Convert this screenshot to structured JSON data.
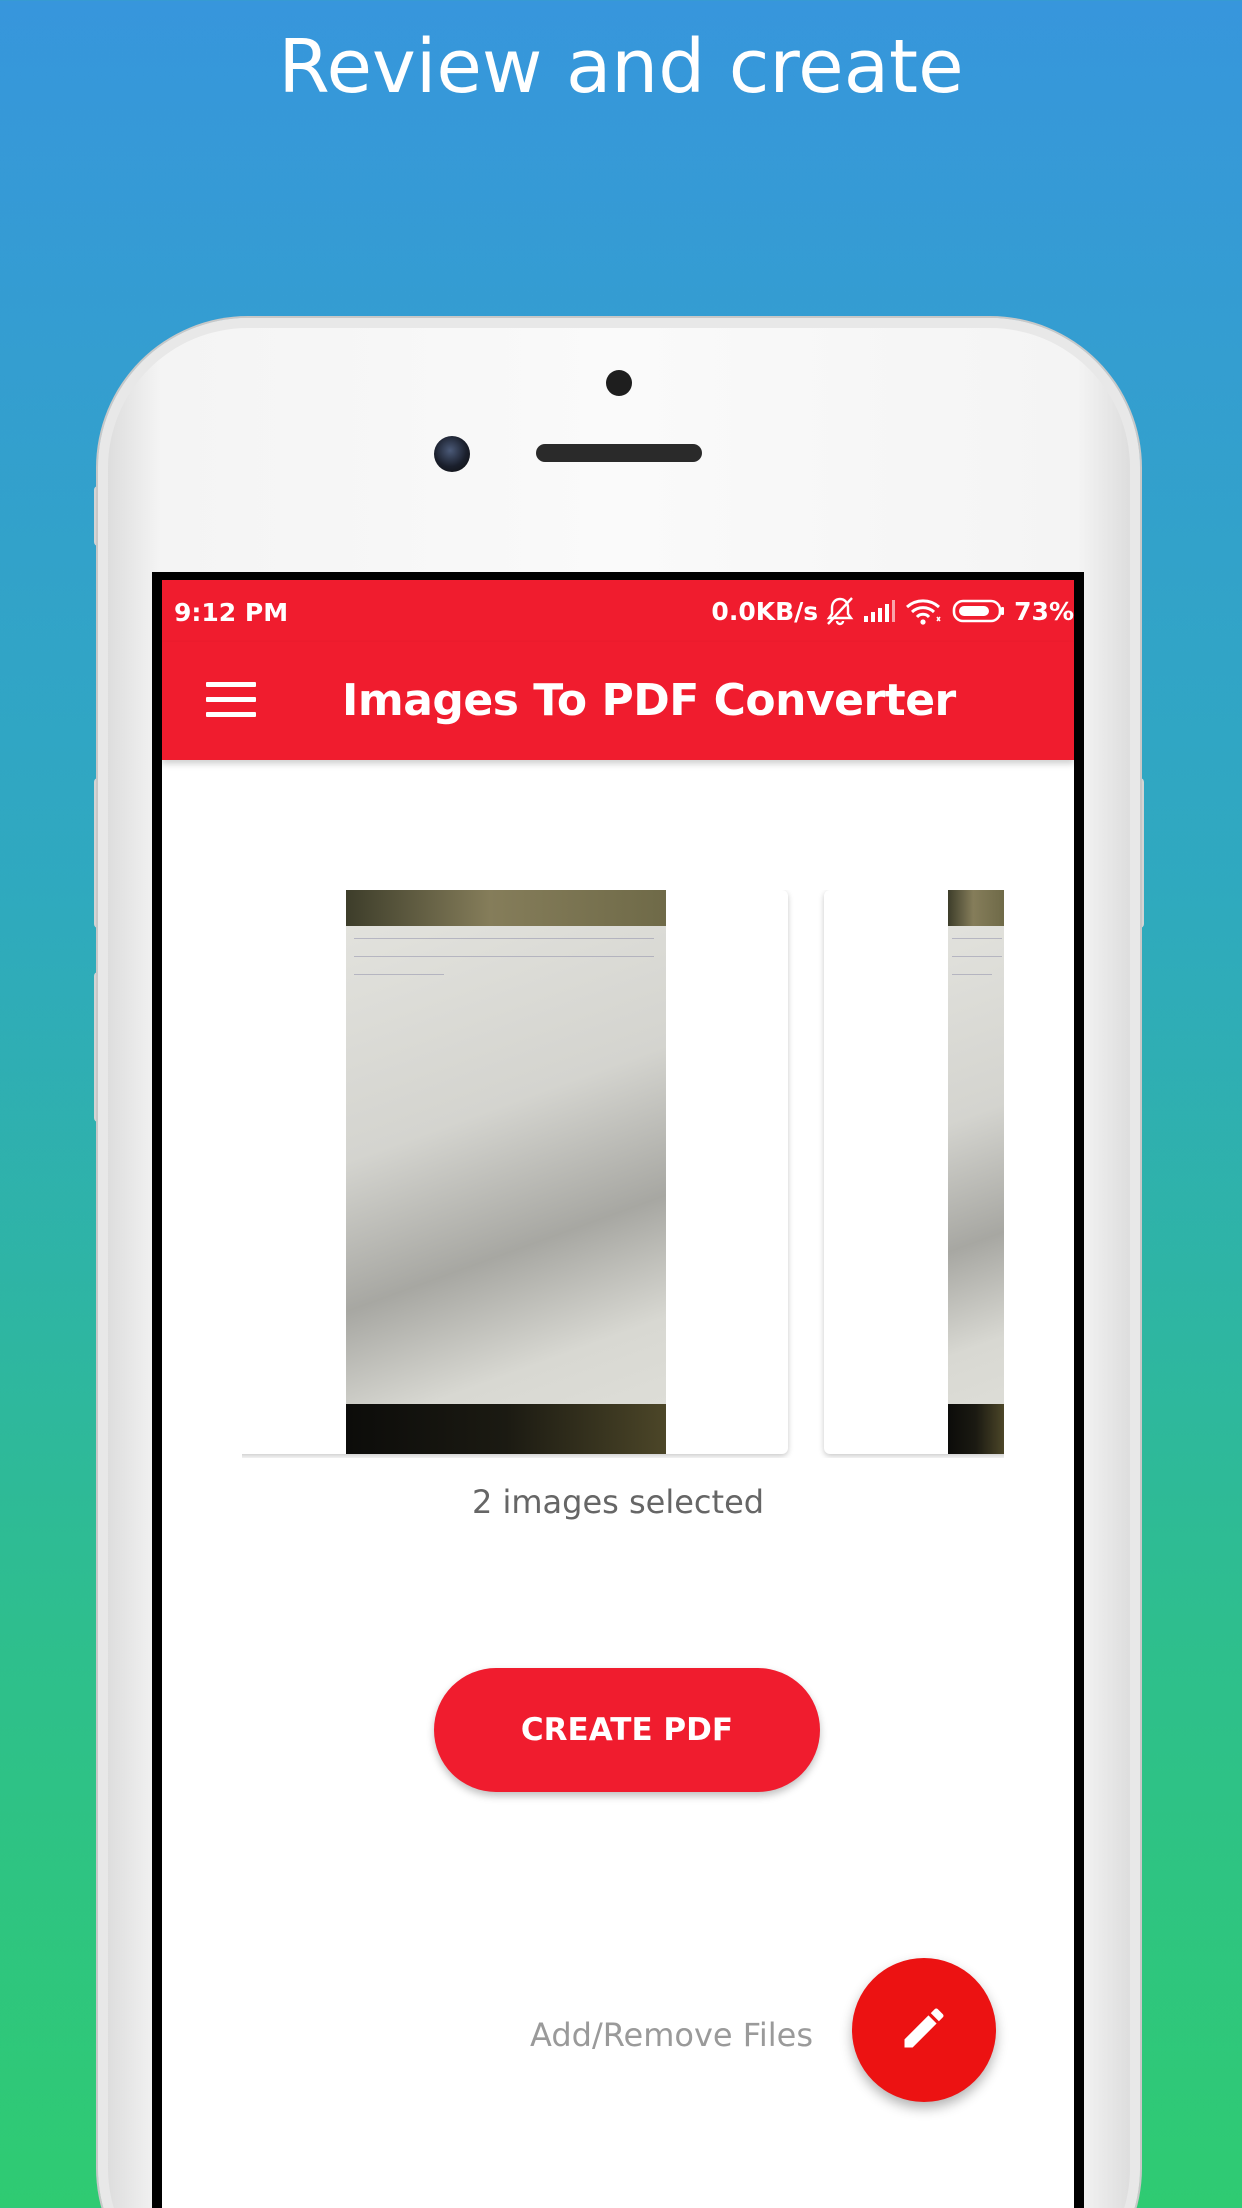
{
  "promo": {
    "title": "Review and create"
  },
  "status_bar": {
    "time": "9:12 PM",
    "network_speed": "0.0KB/s",
    "battery_percent": "73%",
    "icons": [
      "bell-muted-icon",
      "signal-icon",
      "wifi-icon",
      "battery-icon"
    ]
  },
  "app_bar": {
    "title": "Images To PDF Converter",
    "menu_icon": "hamburger-menu-icon"
  },
  "carousel": {
    "images": [
      "page-photo-1",
      "page-photo-2"
    ]
  },
  "selection": {
    "count_text": "2 images selected"
  },
  "actions": {
    "create_pdf_label": "CREATE PDF",
    "add_remove_label": "Add/Remove Files",
    "fab_icon": "pencil-icon"
  },
  "colors": {
    "accent": "#f01c2e",
    "fab": "#ec1212",
    "background_top": "#3796dc",
    "background_bottom": "#2fcb72"
  }
}
